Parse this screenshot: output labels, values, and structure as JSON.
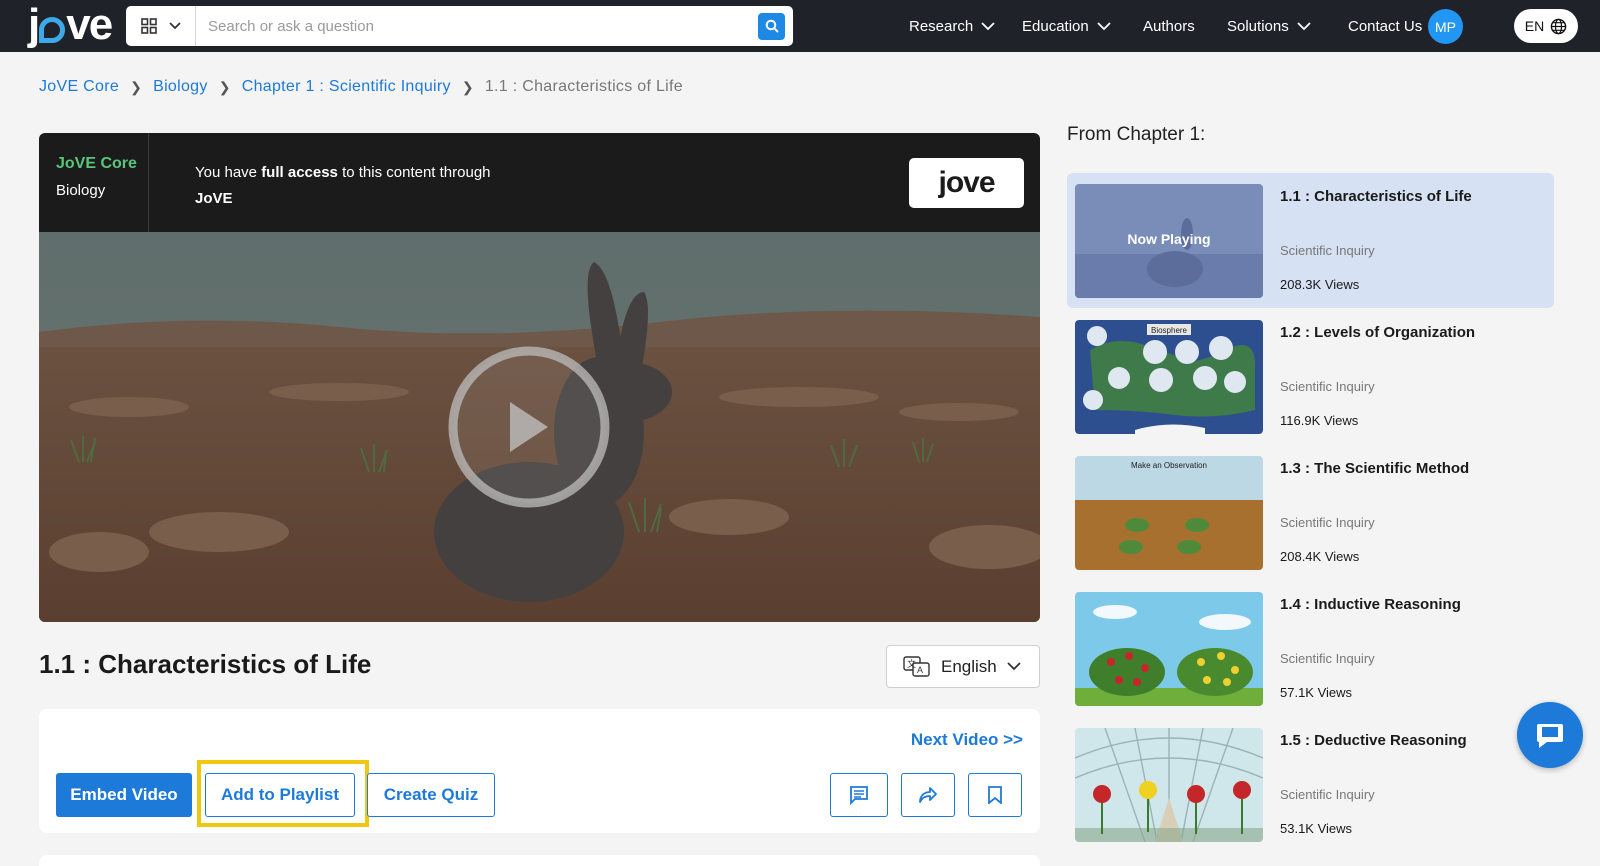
{
  "header": {
    "logo": "jove",
    "search_placeholder": "Search or ask a question",
    "nav": [
      {
        "label": "Research",
        "has_dropdown": true
      },
      {
        "label": "Education",
        "has_dropdown": true
      },
      {
        "label": "Authors",
        "has_dropdown": false
      },
      {
        "label": "Solutions",
        "has_dropdown": true
      },
      {
        "label": "Contact Us",
        "has_dropdown": false
      }
    ],
    "avatar_initials": "MP",
    "language": "EN"
  },
  "breadcrumb": {
    "items": [
      "JoVE Core",
      "Biology",
      "Chapter 1 : Scientific Inquiry"
    ],
    "current": "1.1 : Characteristics of Life"
  },
  "access_bar": {
    "collection": "JoVE Core",
    "subject": "Biology",
    "message_pre": "You have ",
    "message_bold": "full access",
    "message_post": " to this content through",
    "institution": "JoVE",
    "badge": "jove"
  },
  "video": {
    "title": "1.1 : Characteristics of Life",
    "language": "English"
  },
  "actions": {
    "next_video": "Next Video >>",
    "embed": "Embed Video",
    "add_playlist": "Add to Playlist",
    "create_quiz": "Create Quiz",
    "icons": [
      "comment-icon",
      "share-icon",
      "bookmark-icon"
    ]
  },
  "sidebar": {
    "title": "From Chapter 1:",
    "items": [
      {
        "title": "1.1 : Characteristics of Life",
        "category": "Scientific Inquiry",
        "views": "208.3K Views",
        "overlay": "Now Playing",
        "active": true
      },
      {
        "title": "1.2 : Levels of Organization",
        "category": "Scientific Inquiry",
        "views": "116.9K Views",
        "thumb_text": "Biosphere",
        "active": false
      },
      {
        "title": "1.3 : The Scientific Method",
        "category": "Scientific Inquiry",
        "views": "208.4K Views",
        "thumb_text": "Make an Observation",
        "active": false
      },
      {
        "title": "1.4 : Inductive Reasoning",
        "category": "Scientific Inquiry",
        "views": "57.1K Views",
        "active": false
      },
      {
        "title": "1.5 : Deductive Reasoning",
        "category": "Scientific Inquiry",
        "views": "53.1K Views",
        "active": false
      }
    ]
  },
  "colors": {
    "header_bg": "#1f2329",
    "accent": "#1e7ad9",
    "highlight": "#f2c80f",
    "core_green": "#57c67a"
  }
}
